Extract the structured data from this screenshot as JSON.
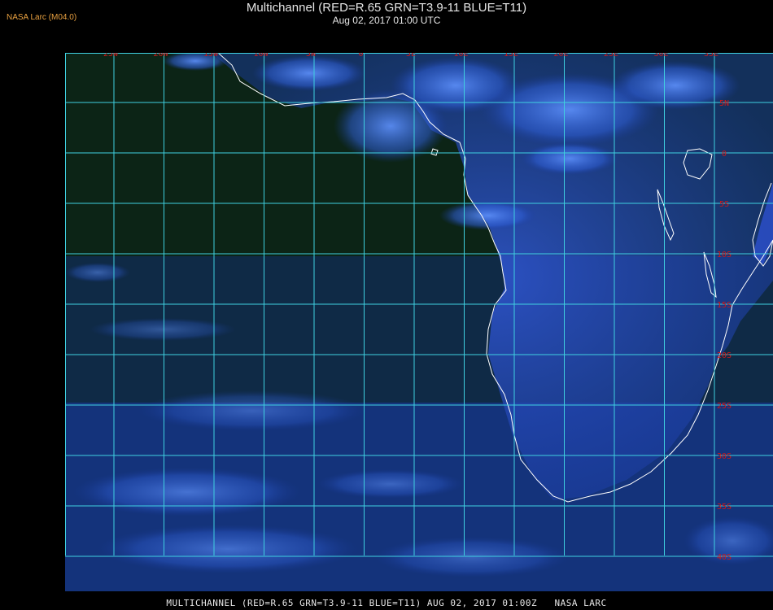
{
  "header": {
    "agency": "NASA Larc (M04.0)",
    "title": "Multichannel (RED=R.65 GRN=T3.9-11 BLUE=T11)",
    "subtitle": "Aug 02, 2017 01:00 UTC"
  },
  "footer": {
    "caption": "MULTICHANNEL (RED=R.65 GRN=T3.9-11 BLUE=T11) AUG 02, 2017 01:00Z   NASA LARC"
  },
  "map": {
    "longitude_labels": [
      "25W",
      "20W",
      "15W",
      "10W",
      "5W",
      "0",
      "5E",
      "10E",
      "15E",
      "20E",
      "25E",
      "30E",
      "35E"
    ],
    "latitude_labels": [
      "5N",
      "0",
      "5S",
      "10S",
      "15S",
      "20S",
      "25S",
      "30S",
      "35S",
      "40S"
    ],
    "colors": {
      "grid": "#3fd0e0",
      "labels": "#d01818",
      "coastline": "#ffffff",
      "ocean": "#0b1f13",
      "cloud": "#3c74e8"
    }
  }
}
